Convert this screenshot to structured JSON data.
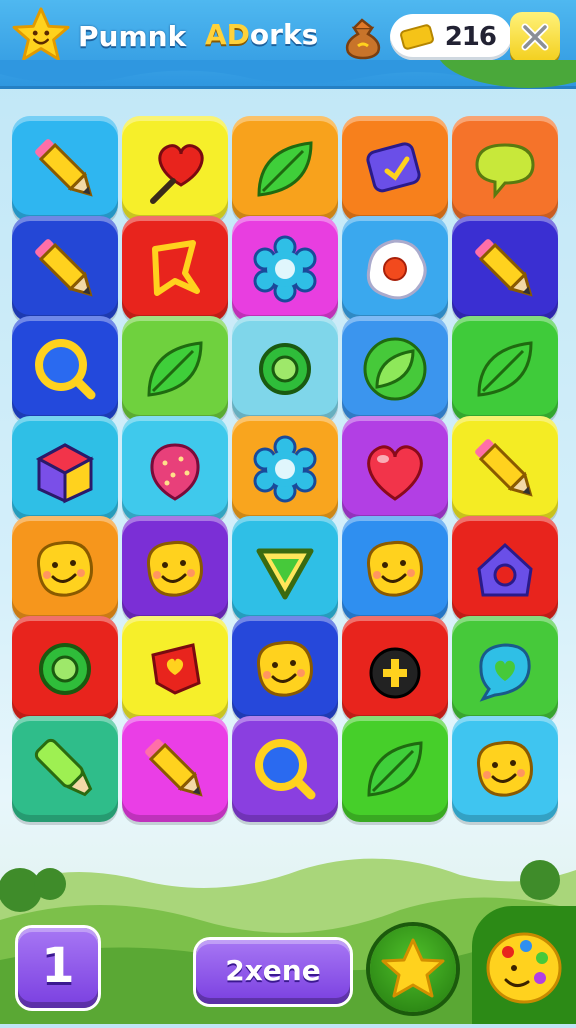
{
  "header": {
    "title_left": "Pumnk",
    "title_right_prefix": "AD",
    "title_right_suffix": "orks",
    "currency_value": "216",
    "icons": {
      "badge": "star-face-icon",
      "bag": "money-bag-icon",
      "currency": "ticket-icon",
      "close": "close-icon"
    }
  },
  "grid": {
    "rows": 7,
    "cols": 5,
    "tiles": [
      {
        "color": "#2fb6f0",
        "icon": "pencil"
      },
      {
        "color": "#f6ef2a",
        "icon": "heart-lollipop"
      },
      {
        "color": "#f8a21c",
        "icon": "leaf"
      },
      {
        "color": "#f7801c",
        "icon": "tag-check"
      },
      {
        "color": "#f5732a",
        "icon": "speech-bubble"
      },
      {
        "color": "#2447d6",
        "icon": "pencil"
      },
      {
        "color": "#e8241d",
        "icon": "shield-outline"
      },
      {
        "color": "#e83ee0",
        "icon": "flower-ring"
      },
      {
        "color": "#3aa8ee",
        "icon": "fried-egg"
      },
      {
        "color": "#3a2fd2",
        "icon": "pencil"
      },
      {
        "color": "#2349dc",
        "icon": "magnifier"
      },
      {
        "color": "#6fd13e",
        "icon": "leaf"
      },
      {
        "color": "#7fd6ea",
        "icon": "ring"
      },
      {
        "color": "#3b95ee",
        "icon": "leaf-circle"
      },
      {
        "color": "#3fcb3a",
        "icon": "leaf"
      },
      {
        "color": "#2fbfe6",
        "icon": "cube"
      },
      {
        "color": "#3fc9ec",
        "icon": "strawberry"
      },
      {
        "color": "#f9a51e",
        "icon": "flower-ring"
      },
      {
        "color": "#b23fe4",
        "icon": "heart"
      },
      {
        "color": "#f4ec24",
        "icon": "pencil"
      },
      {
        "color": "#f6961c",
        "icon": "smiley-blob"
      },
      {
        "color": "#7b2fd6",
        "icon": "smiley-blob"
      },
      {
        "color": "#2fbfe6",
        "icon": "triangle-outline"
      },
      {
        "color": "#2f8ff0",
        "icon": "smiley-blob"
      },
      {
        "color": "#e8241d",
        "icon": "house-ring"
      },
      {
        "color": "#e8241d",
        "icon": "ring"
      },
      {
        "color": "#f6ef2a",
        "icon": "flag-heart"
      },
      {
        "color": "#2648da",
        "icon": "smiley-blob"
      },
      {
        "color": "#e8241d",
        "icon": "bomb"
      },
      {
        "color": "#46c93a",
        "icon": "heart-bubble"
      },
      {
        "color": "#2fbd8a",
        "icon": "marker"
      },
      {
        "color": "#ea3ee6",
        "icon": "pencil"
      },
      {
        "color": "#8a3fe0",
        "icon": "magnifier"
      },
      {
        "color": "#46cf2a",
        "icon": "leaf"
      },
      {
        "color": "#3fc5f0",
        "icon": "smiley-blob"
      }
    ]
  },
  "footer": {
    "level_number": "1",
    "mode_label": "2xene",
    "icons": {
      "star": "star-icon",
      "palette": "palette-face-icon"
    }
  }
}
